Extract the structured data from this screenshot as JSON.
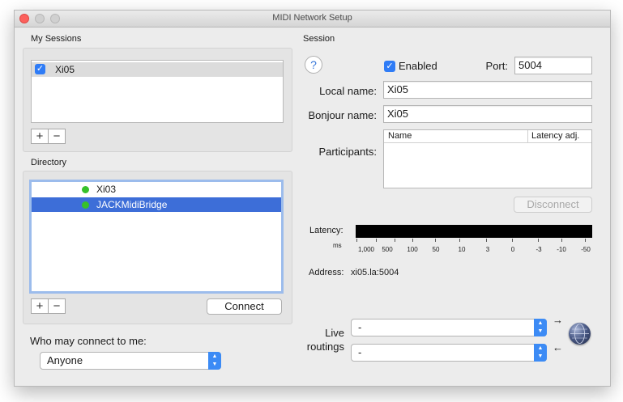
{
  "window": {
    "title": "MIDI Network Setup"
  },
  "sessions": {
    "label": "My Sessions",
    "items": [
      {
        "name": "Xi05",
        "checked": true
      }
    ],
    "add_label": "+",
    "remove_label": "−"
  },
  "directory": {
    "label": "Directory",
    "items": [
      {
        "name": "Xi03",
        "status": "online"
      },
      {
        "name": "JACKMidiBridge",
        "status": "online",
        "selected": true
      }
    ],
    "add_label": "+",
    "remove_label": "−",
    "connect_label": "Connect"
  },
  "who_may_connect": {
    "label": "Who may connect to me:",
    "value": "Anyone"
  },
  "session": {
    "label": "Session",
    "help_label": "?",
    "enabled_label": "Enabled",
    "enabled_checked": true,
    "port_label": "Port:",
    "port_value": "5004",
    "local_name_label": "Local name:",
    "local_name_value": "Xi05",
    "bonjour_name_label": "Bonjour name:",
    "bonjour_name_value": "Xi05",
    "participants_label": "Participants:",
    "participants_columns": [
      "Name",
      "Latency adj."
    ],
    "disconnect_label": "Disconnect",
    "latency_label": "Latency:",
    "latency_unit": "ms",
    "latency_ticks": [
      "1,000",
      "500",
      "100",
      "50",
      "10",
      "3",
      "0",
      "-3",
      "-10",
      "-50"
    ],
    "address_label": "Address:",
    "address_value": "xi05.la:5004",
    "live_routings_label_1": "Live",
    "live_routings_label_2": "routings",
    "routing_in_value": "-",
    "routing_out_value": "-"
  },
  "colors": {
    "accent": "#2f7cf6",
    "selection": "#3d6ed8",
    "online": "#37c12a",
    "close_button": "#fc605c"
  }
}
